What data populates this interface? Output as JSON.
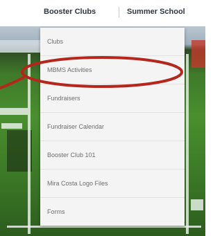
{
  "nav": {
    "items": [
      {
        "label": "Booster Clubs"
      },
      {
        "label": "Summer School"
      }
    ]
  },
  "dropdown": {
    "items": [
      {
        "label": "Clubs"
      },
      {
        "label": "MBMS Activities"
      },
      {
        "label": "Fundraisers"
      },
      {
        "label": "Fundraiser Calendar"
      },
      {
        "label": "Booster Club 101"
      },
      {
        "label": "Mira Costa Logo Files"
      },
      {
        "label": "Forms"
      }
    ]
  },
  "colors": {
    "annotation": "#b5271c",
    "menu_bg": "#f4f4f4",
    "menu_text": "#6e6e6e",
    "nav_text": "#2f3640"
  }
}
